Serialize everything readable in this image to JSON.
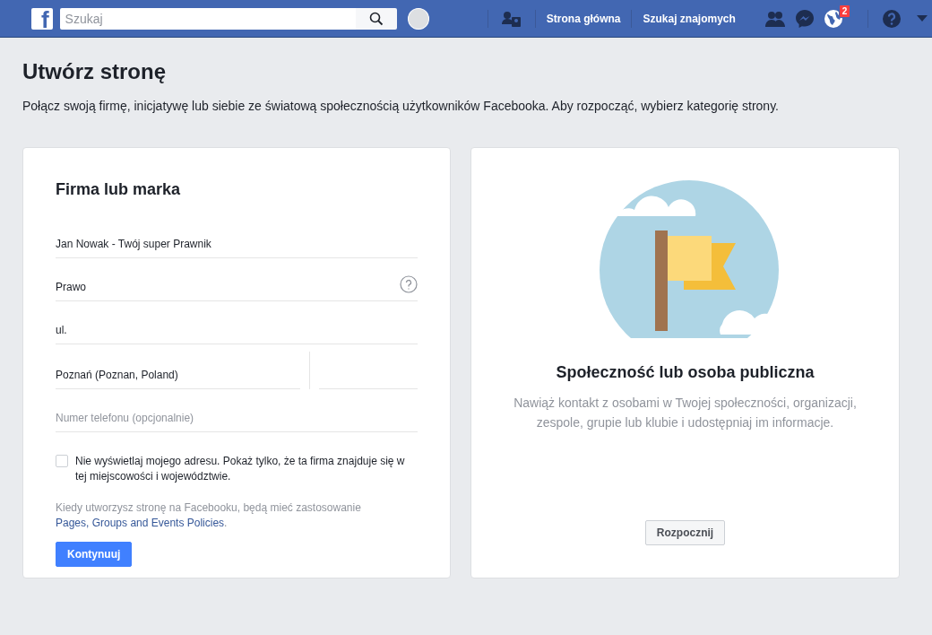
{
  "topbar": {
    "logo": "f",
    "search": {
      "placeholder": "Szukaj"
    },
    "links": [
      "Strona główna",
      "Szukaj znajomych"
    ],
    "notifications_badge": "2"
  },
  "page": {
    "title": "Utwórz stronę",
    "subtitle": "Połącz swoją firmę, inicjatywę lub siebie ze światową społecznością użytkowników Facebooka. Aby rozpocząć, wybierz kategorię strony."
  },
  "business_card": {
    "title": "Firma lub marka",
    "fields": [
      {
        "kind": "text",
        "value": "Jan Nowak - Twój super Prawnik"
      },
      {
        "kind": "help",
        "value": "Prawo"
      },
      {
        "kind": "text",
        "value": "ul."
      },
      {
        "kind": "split",
        "value": "Poznań (Poznan, Poland)"
      },
      {
        "kind": "text",
        "placeholder": "Numer telefonu (opcjonalnie)"
      }
    ],
    "hide_address": {
      "label": "Nie wyświetlaj mojego adresu. Pokaż tylko, że ta firma znajduje się w tej miejscowości i województwie.",
      "checked": false
    },
    "policy_text": "Kiedy utworzysz stronę na Facebooku, będą mieć zastosowanie",
    "policy_link": "Pages, Groups and Events Policies",
    "policy_end": ".",
    "button": "Kontynuuj"
  },
  "community_card": {
    "title": "Społeczność lub osoba publiczna",
    "description": "Nawiąż kontakt z osobami w Twojej społeczności, organizacji, zespole, grupie lub klubie i udostępniaj im informacje.",
    "button": "Rozpocznij"
  }
}
